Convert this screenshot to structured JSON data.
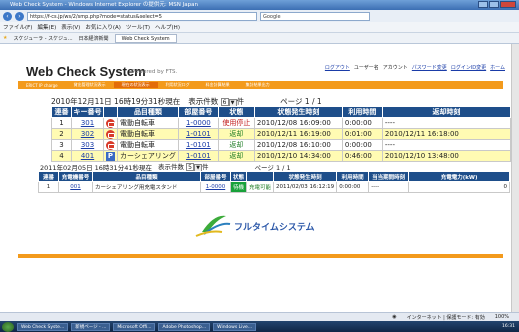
{
  "browser": {
    "title": "Web Check System - Windows Internet Explorer の提供元: MSN Japan",
    "url": "https://f-cs.jp/ws/2/smp.php?mode=status&select=5",
    "search_placeholder": "Google",
    "menu": [
      "ファイル(F)",
      "編集(E)",
      "表示(V)",
      "お気に入り(A)",
      "ツール(T)",
      "ヘルプ(H)"
    ],
    "favorites": [
      "お気に入り",
      "スケジューラ - スケジュ...",
      "日本経済新聞"
    ],
    "tab": "Web Check System",
    "status_zone": "インターネット | 保護モード: 有効",
    "zoom": "100%"
  },
  "header": {
    "logo": "Web Check System",
    "powered": "Powered by FTS.",
    "links": [
      {
        "label": "ログアウト"
      },
      {
        "label": "ユーザー名",
        "plain": true
      },
      {
        "label": "アカウント",
        "plain": true
      },
      {
        "label": "パスワード変更"
      },
      {
        "label": "ログインID変更"
      },
      {
        "label": "ホーム"
      }
    ]
  },
  "nav": {
    "items": [
      "ERICT IP charge",
      "貸出管理状況表示",
      "現在の状況表示",
      "利用状況ログ",
      "料金計算結果",
      "集計結果出力"
    ],
    "selected_index": 2
  },
  "status1": {
    "timestamp": "2010年12月11日 16時19分31秒現在",
    "count_label": "表示件数",
    "count_value": "6",
    "count_unit": "件",
    "page": "ページ 1 / 1"
  },
  "table1": {
    "headers": [
      "連番",
      "キー番号",
      "",
      "品目種類",
      "部屋番号",
      "状態",
      "状態発生時刻",
      "利用時間",
      "返却時刻"
    ],
    "rows": [
      {
        "no": "1",
        "key": "301",
        "icon": "bicycle-icon",
        "type": "電動自転車",
        "room": "1-0000",
        "state": "使用停止",
        "state_color": "red",
        "time": "2010/12/08 16:09:00",
        "duration": "0:00:00",
        "return": "----"
      },
      {
        "no": "2",
        "key": "302",
        "icon": "bicycle-icon",
        "type": "電動自転車",
        "room": "1-0101",
        "state": "返却",
        "state_color": "green",
        "time": "2010/12/11 16:19:00",
        "duration": "0:01:00",
        "return": "2010/12/11 16:18:00"
      },
      {
        "no": "3",
        "key": "303",
        "icon": "bicycle-icon",
        "type": "電動自転車",
        "room": "1-0101",
        "state": "返却",
        "state_color": "green",
        "time": "2010/12/08 16:10:00",
        "duration": "0:00:00",
        "return": "----"
      },
      {
        "no": "4",
        "key": "401",
        "icon": "parking-icon",
        "type": "カーシェアリング",
        "room": "1-0101",
        "state": "返却",
        "state_color": "green",
        "time": "2010/12/10 14:34:00",
        "duration": "0:46:00",
        "return": "2010/12/10 13:48:00"
      }
    ]
  },
  "status2": {
    "timestamp": "2011年02月05日 16時31分41秒現在",
    "count_label": "表示件数",
    "count_value": "5",
    "count_unit": "件",
    "page": "ページ 1 / 1"
  },
  "table2": {
    "headers": [
      "連番",
      "充電機番号",
      "品目種類",
      "部屋番号",
      "状態",
      "",
      "状態発生時刻",
      "利用時間",
      "当当期間時刻",
      "充電電力(kW)"
    ],
    "rows": [
      {
        "no": "1",
        "charger": "001",
        "type": "カーシェアリング用充電スタンド",
        "room": "1-0000",
        "state": "待機",
        "charge": "充電可能",
        "time": "2011/02/03 16:12:19",
        "duration": "0:00:00",
        "period": "----",
        "kw": "0"
      }
    ]
  },
  "footer": {
    "brand": "フルタイムシステム"
  },
  "taskbar": {
    "items": [
      "Web Check Syste...",
      "新規ページ - ...",
      "Microsoft Offi...",
      "Adobe Photoshop...",
      "Windows Live..."
    ],
    "clock": "16:31"
  }
}
